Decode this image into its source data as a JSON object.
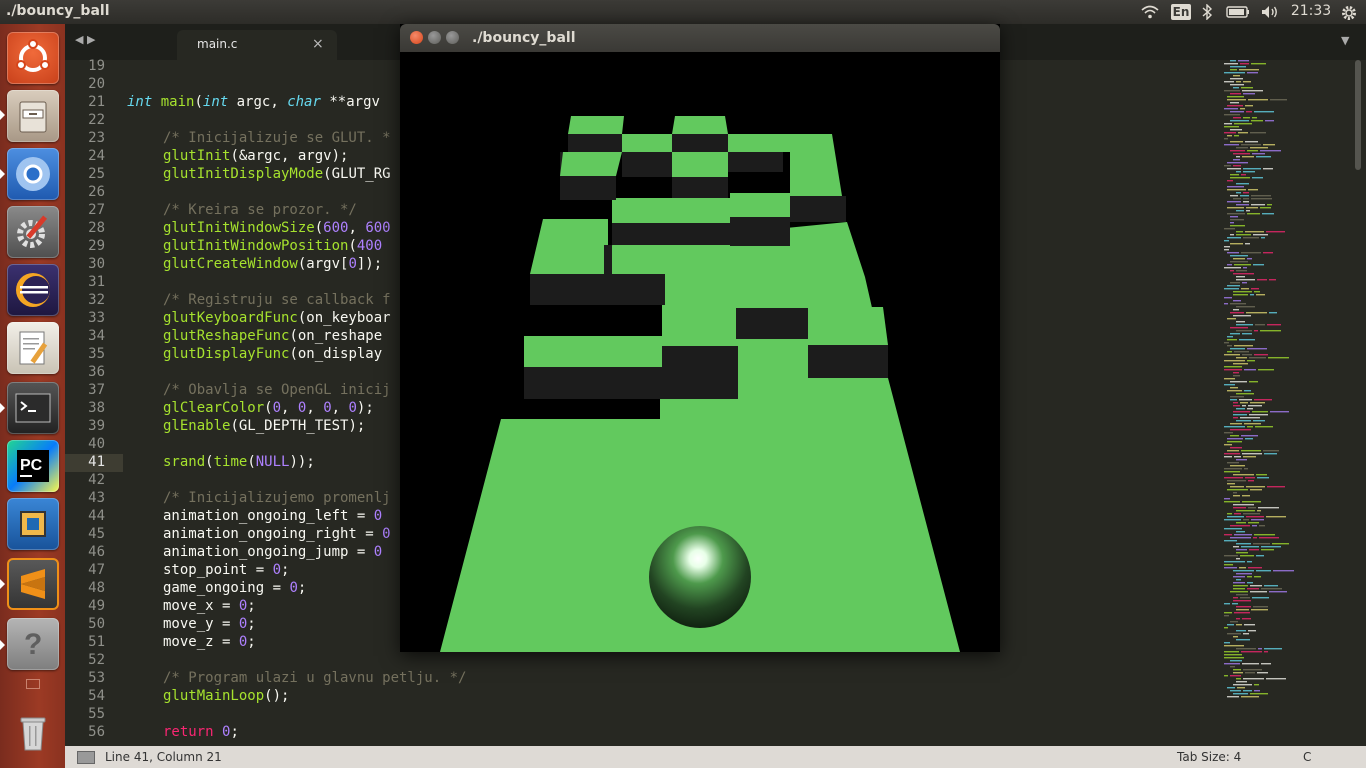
{
  "topbar": {
    "window_title": "./bouncy_ball",
    "keyboard_layout": "En",
    "clock": "21:33"
  },
  "launcher": {
    "items": [
      {
        "name": "ubuntu-dash",
        "icon": "ubuntu-logo-icon",
        "color": "#dd4814"
      },
      {
        "name": "files",
        "icon": "file-cabinet-icon",
        "color": "#8c7b6b"
      },
      {
        "name": "chromium",
        "icon": "chromium-icon",
        "color": "#2a6fc9"
      },
      {
        "name": "system-settings",
        "icon": "gear-wrench-icon",
        "color": "#6b6b6b"
      },
      {
        "name": "eclipse",
        "icon": "eclipse-icon",
        "color": "#2c2255"
      },
      {
        "name": "text-editor",
        "icon": "notepad-pencil-icon",
        "color": "#d8d4c8"
      },
      {
        "name": "terminal",
        "icon": "terminal-icon",
        "color": "#2b2b2b"
      },
      {
        "name": "pycharm",
        "icon": "pycharm-icon",
        "color": "#1c1c1c"
      },
      {
        "name": "virtualbox",
        "icon": "virtualbox-icon",
        "color": "#1f69b3"
      },
      {
        "name": "sublime-text",
        "icon": "sublime-icon",
        "color": "#4b4b4b"
      },
      {
        "name": "help",
        "icon": "question-icon",
        "color": "#8a8a8a"
      },
      {
        "name": "trash",
        "icon": "trash-icon",
        "color": "#9a9a9a"
      }
    ]
  },
  "editor": {
    "tab_label": "main.c",
    "tab_close": "×",
    "nav_arrows": "◀ ▶",
    "dropdown": "▼",
    "current_line": "41",
    "lines": [
      {
        "n": "19"
      },
      {
        "n": "20"
      },
      {
        "n": "21"
      },
      {
        "n": "22"
      },
      {
        "n": "23"
      },
      {
        "n": "24"
      },
      {
        "n": "25"
      },
      {
        "n": "26"
      },
      {
        "n": "27"
      },
      {
        "n": "28"
      },
      {
        "n": "29"
      },
      {
        "n": "30"
      },
      {
        "n": "31"
      },
      {
        "n": "32"
      },
      {
        "n": "33"
      },
      {
        "n": "34"
      },
      {
        "n": "35"
      },
      {
        "n": "36"
      },
      {
        "n": "37"
      },
      {
        "n": "38"
      },
      {
        "n": "39"
      },
      {
        "n": "40"
      },
      {
        "n": "41"
      },
      {
        "n": "42"
      },
      {
        "n": "43"
      },
      {
        "n": "44"
      },
      {
        "n": "45"
      },
      {
        "n": "46"
      },
      {
        "n": "47"
      },
      {
        "n": "48"
      },
      {
        "n": "49"
      },
      {
        "n": "50"
      },
      {
        "n": "51"
      },
      {
        "n": "52"
      },
      {
        "n": "53"
      },
      {
        "n": "54"
      },
      {
        "n": "55"
      },
      {
        "n": "56"
      }
    ],
    "code": {
      "l21": {
        "a": "int",
        "b": " main",
        "c": "(",
        "d": "int",
        "e": " argc, ",
        "f": "char",
        "g": " **argv"
      },
      "l23": "/* Inicijalizuje se GLUT. *",
      "l24": {
        "f": "glutInit",
        "r": "(&argc, argv);"
      },
      "l25": {
        "f": "glutInitDisplayMode",
        "r": "(GLUT_RG"
      },
      "l27": "/* Kreira se prozor. */",
      "l28": {
        "f": "glutInitWindowSize",
        "r": "(",
        "n1": "600",
        "s": ", ",
        "n2": "600"
      },
      "l29": {
        "f": "glutInitWindowPosition",
        "r": "(",
        "n1": "400"
      },
      "l30": {
        "f": "glutCreateWindow",
        "r": "(argv[",
        "n1": "0",
        "s": "]);"
      },
      "l32": "/* Registruju se callback f",
      "l33": {
        "f": "glutKeyboardFunc",
        "r": "(on_keyboar"
      },
      "l34": {
        "f": "glutReshapeFunc",
        "r": "(on_reshape"
      },
      "l35": {
        "f": "glutDisplayFunc",
        "r": "(on_display"
      },
      "l37": "/* Obavlja se OpenGL inicij",
      "l38": {
        "f": "glClearColor",
        "r": "(",
        "n1": "0",
        "s1": ", ",
        "n2": "0",
        "s2": ", ",
        "n3": "0",
        "s3": ", ",
        "n4": "0",
        "e": ");"
      },
      "l39": {
        "f": "glEnable",
        "r": "(GL_DEPTH_TEST);"
      },
      "l41": {
        "f": "srand",
        "p": "(",
        "f2": "time",
        "p2": "(",
        "k": "NULL",
        "e": "));"
      },
      "l43": "/* Inicijalizujemo promenlj",
      "l44": {
        "t": "animation_ongoing_left = ",
        "n": "0"
      },
      "l45": {
        "t": "animation_ongoing_right = ",
        "n": "0"
      },
      "l46": {
        "t": "animation_ongoing_jump = ",
        "n": "0"
      },
      "l47": {
        "t": "stop_point = ",
        "n": "0",
        "e": ";"
      },
      "l48": {
        "t": "game_ongoing = ",
        "n": "0",
        "e": ";"
      },
      "l49": {
        "t": "move_x = ",
        "n": "0",
        "e": ";"
      },
      "l50": {
        "t": "move_y = ",
        "n": "0",
        "e": ";"
      },
      "l51": {
        "t": "move_z = ",
        "n": "0",
        "e": ";"
      },
      "l53": "/* Program ulazi u glavnu petlju. */",
      "l54": {
        "f": "glutMainLoop",
        "r": "();"
      },
      "l56": {
        "k": "return",
        "n": " 0",
        "e": ";"
      }
    }
  },
  "status": {
    "position": "Line 41, Column 21",
    "tab_size": "Tab Size: 4",
    "syntax": "C"
  },
  "game_window": {
    "title": "./bouncy_ball",
    "floor_color": "#62c95e",
    "block_dark": "#1c1c1c",
    "background": "#000000"
  }
}
